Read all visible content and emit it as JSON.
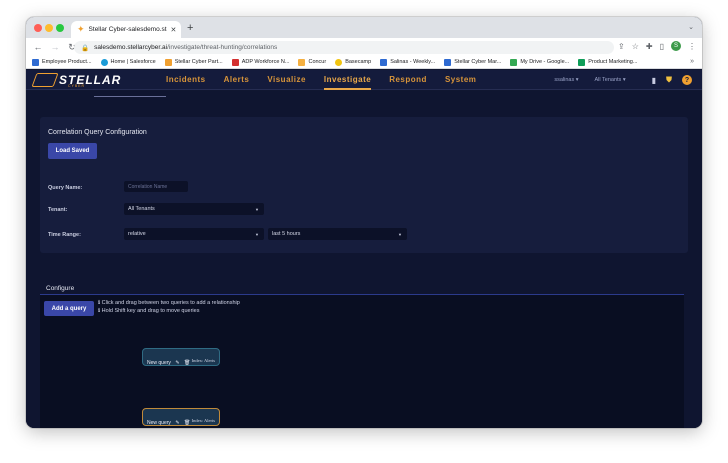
{
  "browser": {
    "tab_title": "Stellar Cyber-salesdemo.stella",
    "new_tab_symbol": "+",
    "url_host": "salesdemo.stellarcyber.ai",
    "url_path": "/investigate/threat-hunting/correlations",
    "avatar_letter": "S",
    "bookmarks": [
      {
        "label": "Employee Product...",
        "color": "#2e6ad1"
      },
      {
        "label": "Home | Salesforce",
        "color": "#1a9bd7"
      },
      {
        "label": "Stellar Cyber Part...",
        "color": "#f0a030"
      },
      {
        "label": "ADP Workforce N...",
        "color": "#d32f2f"
      },
      {
        "label": "Concur",
        "color": "#f5b041"
      },
      {
        "label": "Basecamp",
        "color": "#f1c40f"
      },
      {
        "label": "Salinas - Weekly...",
        "color": "#2e6ad1"
      },
      {
        "label": "Stellar Cyber Mar...",
        "color": "#2e6ad1"
      },
      {
        "label": "My Drive - Google...",
        "color": "#34a853"
      },
      {
        "label": "Product Marketing...",
        "color": "#0f9d58"
      }
    ]
  },
  "app": {
    "logo_text": "STELLAR",
    "logo_sub": "CYBER",
    "menu": [
      {
        "label": "Incidents",
        "active": false
      },
      {
        "label": "Alerts",
        "active": false
      },
      {
        "label": "Visualize",
        "active": false
      },
      {
        "label": "Investigate",
        "active": true
      },
      {
        "label": "Respond",
        "active": false
      },
      {
        "label": "System",
        "active": false
      }
    ],
    "user_select": "ssalinas ▾",
    "tenant_select": "All Tenants ▾",
    "help_label": "?"
  },
  "config": {
    "title": "Correlation Query Configuration",
    "load_saved_label": "Load Saved",
    "query_name_label": "Query Name:",
    "query_name_placeholder": "Correlation Name",
    "tenant_label": "Tenant:",
    "tenant_value": "All Tenants",
    "time_range_label": "Time Range:",
    "time_range_value": "relative",
    "time_range_period": "last 5 hours"
  },
  "canvas": {
    "tab_label": "Configure",
    "add_query_label": "Add a query",
    "hint_1": "ℹ Click and drag between two queries to add a relationship",
    "hint_2": "ℹ Hold Shift key and drag to move queries",
    "nodes": [
      {
        "title": "New query",
        "index": "Index: Alerts",
        "selected": false
      },
      {
        "title": "New query",
        "index": "Index: Alerts",
        "selected": true
      }
    ]
  },
  "colors": {
    "accent_orange": "#e9a84a",
    "primary_button": "#3a47a8",
    "background": "#0f1530"
  }
}
